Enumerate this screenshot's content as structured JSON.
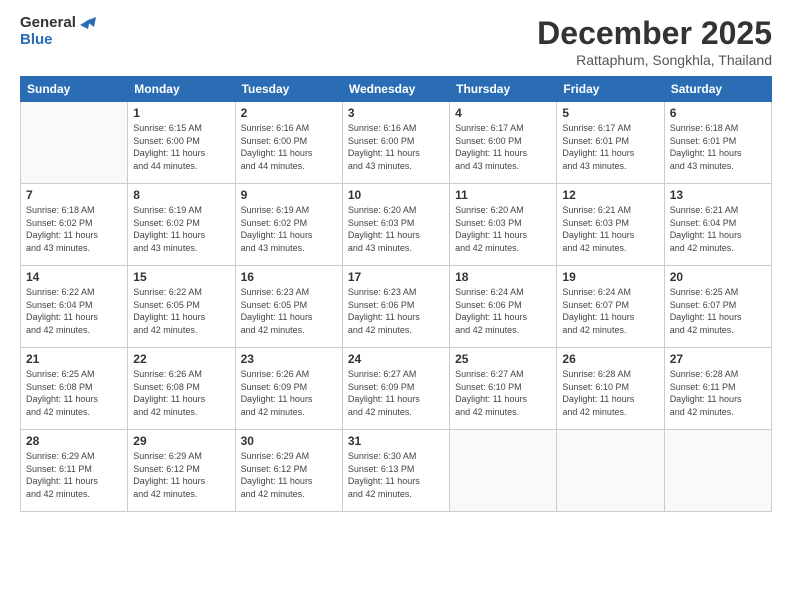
{
  "header": {
    "logo_general": "General",
    "logo_blue": "Blue",
    "month_title": "December 2025",
    "subtitle": "Rattaphum, Songkhla, Thailand"
  },
  "weekdays": [
    "Sunday",
    "Monday",
    "Tuesday",
    "Wednesday",
    "Thursday",
    "Friday",
    "Saturday"
  ],
  "weeks": [
    [
      {
        "day": "",
        "info": ""
      },
      {
        "day": "1",
        "info": "Sunrise: 6:15 AM\nSunset: 6:00 PM\nDaylight: 11 hours\nand 44 minutes."
      },
      {
        "day": "2",
        "info": "Sunrise: 6:16 AM\nSunset: 6:00 PM\nDaylight: 11 hours\nand 44 minutes."
      },
      {
        "day": "3",
        "info": "Sunrise: 6:16 AM\nSunset: 6:00 PM\nDaylight: 11 hours\nand 43 minutes."
      },
      {
        "day": "4",
        "info": "Sunrise: 6:17 AM\nSunset: 6:00 PM\nDaylight: 11 hours\nand 43 minutes."
      },
      {
        "day": "5",
        "info": "Sunrise: 6:17 AM\nSunset: 6:01 PM\nDaylight: 11 hours\nand 43 minutes."
      },
      {
        "day": "6",
        "info": "Sunrise: 6:18 AM\nSunset: 6:01 PM\nDaylight: 11 hours\nand 43 minutes."
      }
    ],
    [
      {
        "day": "7",
        "info": "Sunrise: 6:18 AM\nSunset: 6:02 PM\nDaylight: 11 hours\nand 43 minutes."
      },
      {
        "day": "8",
        "info": "Sunrise: 6:19 AM\nSunset: 6:02 PM\nDaylight: 11 hours\nand 43 minutes."
      },
      {
        "day": "9",
        "info": "Sunrise: 6:19 AM\nSunset: 6:02 PM\nDaylight: 11 hours\nand 43 minutes."
      },
      {
        "day": "10",
        "info": "Sunrise: 6:20 AM\nSunset: 6:03 PM\nDaylight: 11 hours\nand 43 minutes."
      },
      {
        "day": "11",
        "info": "Sunrise: 6:20 AM\nSunset: 6:03 PM\nDaylight: 11 hours\nand 42 minutes."
      },
      {
        "day": "12",
        "info": "Sunrise: 6:21 AM\nSunset: 6:03 PM\nDaylight: 11 hours\nand 42 minutes."
      },
      {
        "day": "13",
        "info": "Sunrise: 6:21 AM\nSunset: 6:04 PM\nDaylight: 11 hours\nand 42 minutes."
      }
    ],
    [
      {
        "day": "14",
        "info": "Sunrise: 6:22 AM\nSunset: 6:04 PM\nDaylight: 11 hours\nand 42 minutes."
      },
      {
        "day": "15",
        "info": "Sunrise: 6:22 AM\nSunset: 6:05 PM\nDaylight: 11 hours\nand 42 minutes."
      },
      {
        "day": "16",
        "info": "Sunrise: 6:23 AM\nSunset: 6:05 PM\nDaylight: 11 hours\nand 42 minutes."
      },
      {
        "day": "17",
        "info": "Sunrise: 6:23 AM\nSunset: 6:06 PM\nDaylight: 11 hours\nand 42 minutes."
      },
      {
        "day": "18",
        "info": "Sunrise: 6:24 AM\nSunset: 6:06 PM\nDaylight: 11 hours\nand 42 minutes."
      },
      {
        "day": "19",
        "info": "Sunrise: 6:24 AM\nSunset: 6:07 PM\nDaylight: 11 hours\nand 42 minutes."
      },
      {
        "day": "20",
        "info": "Sunrise: 6:25 AM\nSunset: 6:07 PM\nDaylight: 11 hours\nand 42 minutes."
      }
    ],
    [
      {
        "day": "21",
        "info": "Sunrise: 6:25 AM\nSunset: 6:08 PM\nDaylight: 11 hours\nand 42 minutes."
      },
      {
        "day": "22",
        "info": "Sunrise: 6:26 AM\nSunset: 6:08 PM\nDaylight: 11 hours\nand 42 minutes."
      },
      {
        "day": "23",
        "info": "Sunrise: 6:26 AM\nSunset: 6:09 PM\nDaylight: 11 hours\nand 42 minutes."
      },
      {
        "day": "24",
        "info": "Sunrise: 6:27 AM\nSunset: 6:09 PM\nDaylight: 11 hours\nand 42 minutes."
      },
      {
        "day": "25",
        "info": "Sunrise: 6:27 AM\nSunset: 6:10 PM\nDaylight: 11 hours\nand 42 minutes."
      },
      {
        "day": "26",
        "info": "Sunrise: 6:28 AM\nSunset: 6:10 PM\nDaylight: 11 hours\nand 42 minutes."
      },
      {
        "day": "27",
        "info": "Sunrise: 6:28 AM\nSunset: 6:11 PM\nDaylight: 11 hours\nand 42 minutes."
      }
    ],
    [
      {
        "day": "28",
        "info": "Sunrise: 6:29 AM\nSunset: 6:11 PM\nDaylight: 11 hours\nand 42 minutes."
      },
      {
        "day": "29",
        "info": "Sunrise: 6:29 AM\nSunset: 6:12 PM\nDaylight: 11 hours\nand 42 minutes."
      },
      {
        "day": "30",
        "info": "Sunrise: 6:29 AM\nSunset: 6:12 PM\nDaylight: 11 hours\nand 42 minutes."
      },
      {
        "day": "31",
        "info": "Sunrise: 6:30 AM\nSunset: 6:13 PM\nDaylight: 11 hours\nand 42 minutes."
      },
      {
        "day": "",
        "info": ""
      },
      {
        "day": "",
        "info": ""
      },
      {
        "day": "",
        "info": ""
      }
    ]
  ]
}
